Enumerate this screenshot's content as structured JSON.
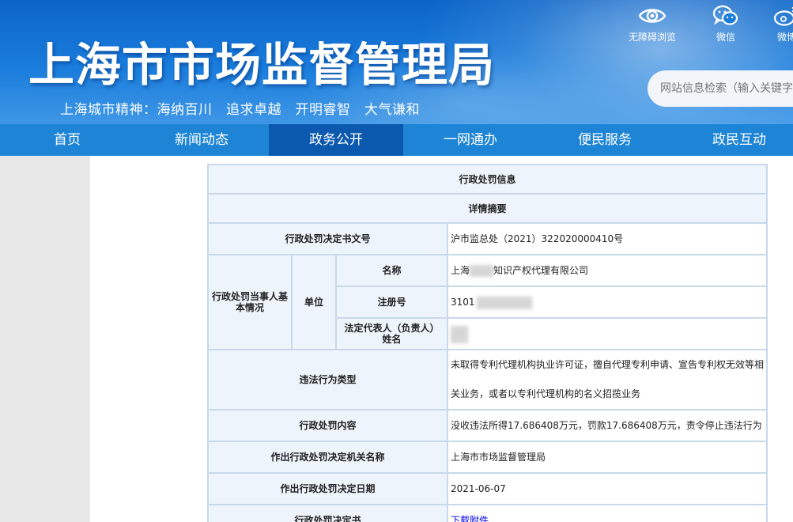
{
  "header": {
    "site_title": "上海市市场监督管理局",
    "slogan": "上海城市精神：海纳百川　追求卓越　开明睿智　大气谦和",
    "tools": {
      "accessibility_label": "无障碍浏览",
      "weixin_label": "微信",
      "weibo_label": "微博"
    },
    "search": {
      "placeholder": "网站信息检索（输入关键字）"
    }
  },
  "nav": {
    "items": [
      {
        "label": "首页"
      },
      {
        "label": "新闻动态"
      },
      {
        "label": "政务公开"
      },
      {
        "label": "一网通办"
      },
      {
        "label": "便民服务"
      },
      {
        "label": "政民互动"
      }
    ],
    "active_index": 2
  },
  "table": {
    "title": "行政处罚信息",
    "subtitle": "详情摘要",
    "rows": {
      "doc_no_label": "行政处罚决定书文号",
      "doc_no_value": "沪市监总处（2021）322020000410号",
      "party_label": "行政处罚当事人基本情况",
      "unit_label": "单位",
      "name_label": "名称",
      "name_value_prefix": "上海",
      "name_value_suffix": "知识产权代理有限公司",
      "reg_label": "注册号",
      "reg_value_prefix": "3101",
      "legal_rep_label": "法定代表人（负责人）姓名",
      "violation_type_label": "违法行为类型",
      "violation_type_value": "未取得专利代理机构执业许可证，擅自代理专利申请、宣告专利权无效等相关业务，或者以专利代理机构的名义招揽业务",
      "penalty_content_label": "行政处罚内容",
      "penalty_content_value": "没收违法所得17.686408万元，罚款17.686408万元，责令停止违法行为",
      "authority_label": "作出行政处罚决定机关名称",
      "authority_value": "上海市市场监督管理局",
      "date_label": "作出行政处罚决定日期",
      "date_value": "2021-06-07",
      "decision_doc_label": "行政处罚决定书",
      "decision_doc_link": "下载附件"
    }
  },
  "colors": {
    "header_blue": "#1a7ddc",
    "nav_blue": "#1e85d6",
    "nav_active": "#0b59ae",
    "table_border": "#c8d9ea",
    "label_bg": "#eef4fb"
  }
}
